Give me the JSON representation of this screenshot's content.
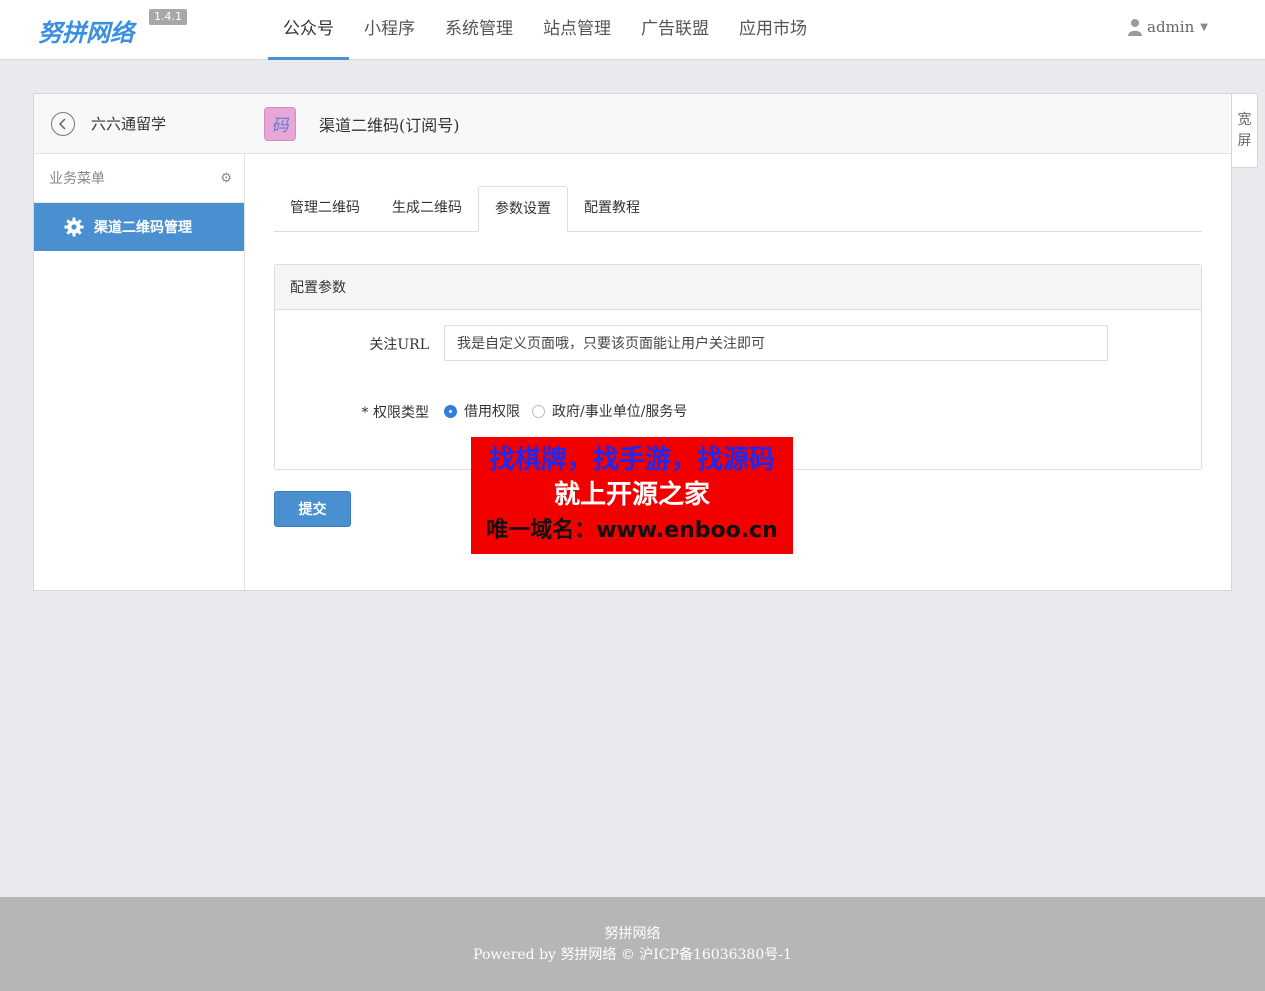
{
  "header": {
    "logo_text": "努拼网络",
    "version": "1.4.1",
    "nav": [
      {
        "label": "公众号",
        "active": true
      },
      {
        "label": "小程序"
      },
      {
        "label": "系统管理"
      },
      {
        "label": "站点管理"
      },
      {
        "label": "广告联盟"
      },
      {
        "label": "应用市场"
      }
    ],
    "user": "admin"
  },
  "sidebar": {
    "title": "六六通留学",
    "menu_header": "业务菜单",
    "items": [
      {
        "label": "渠道二维码管理",
        "active": true
      }
    ]
  },
  "content": {
    "app_icon_char": "码",
    "title": "渠道二维码(订阅号)",
    "tabs": [
      {
        "label": "管理二维码"
      },
      {
        "label": "生成二维码"
      },
      {
        "label": "参数设置",
        "active": true
      },
      {
        "label": "配置教程"
      }
    ],
    "box_title": "配置参数",
    "form": {
      "url_label": "关注URL",
      "url_value": "我是自定义页面哦，只要该页面能让用户关注即可",
      "perm_label": "* 权限类型",
      "perm_options": [
        {
          "label": "借用权限",
          "checked": true
        },
        {
          "label": "政府/事业单位/服务号",
          "checked": false
        }
      ]
    },
    "submit_label": "提交"
  },
  "wide_button": {
    "line1": "宽",
    "line2": "屏"
  },
  "ad": {
    "line1": "找棋牌，找手游，找源码",
    "line2": "就上开源之家",
    "line3": "唯一域名：www.enboo.cn"
  },
  "footer": {
    "line1": "努拼网络",
    "line2": "Powered by 努拼网络 © 沪ICP备16036380号-1"
  },
  "colors": {
    "accent": "#4a8fd0",
    "ad_bg": "#f20000",
    "footer_bg": "#b6b6b6"
  }
}
